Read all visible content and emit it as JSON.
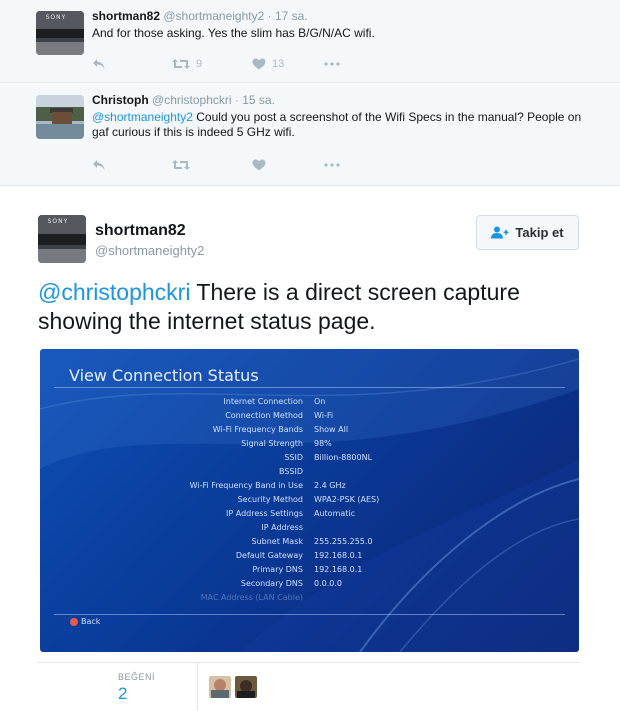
{
  "replies": [
    {
      "fullname": "shortman82",
      "handle": "@shortmaneighty2",
      "separator": "·",
      "time": "17 sa.",
      "text": "And for those asking. Yes the slim has B/G/N/AC wifi.",
      "retweets": "9",
      "likes": "13",
      "avatar_label": "SONY"
    },
    {
      "fullname": "Christoph",
      "handle": "@christophckri",
      "separator": "·",
      "time": "15 sa.",
      "mention": "@shortmaneighty2",
      "text": " Could you post a screenshot of the Wifi Specs in the manual? People on gaf curious if this is indeed 5 GHz wifi.",
      "retweets": "",
      "likes": ""
    }
  ],
  "main_tweet": {
    "fullname": "shortman82",
    "handle": "@shortmaneighty2",
    "avatar_label": "SONY",
    "follow_label": "Takip et",
    "mention": "@christophckri",
    "text": " There is a direct screen capture showing the internet status page."
  },
  "media": {
    "title": "View Connection Status",
    "rows": [
      {
        "k": "Internet Connection",
        "v": "On"
      },
      {
        "k": "Connection Method",
        "v": "Wi-Fi"
      },
      {
        "k": "Wi-Fi Frequency Bands",
        "v": "Show All"
      },
      {
        "k": "Signal Strength",
        "v": "98%"
      },
      {
        "k": "SSID",
        "v": "Billion-8800NL"
      },
      {
        "k": "BSSID",
        "v": ""
      },
      {
        "k": "Wi-Fi Frequency Band in Use",
        "v": "2.4 GHz"
      },
      {
        "k": "Security Method",
        "v": "WPA2-PSK (AES)"
      },
      {
        "k": "IP Address Settings",
        "v": "Automatic"
      },
      {
        "k": "IP Address",
        "v": ""
      },
      {
        "k": "Subnet Mask",
        "v": "255.255.255.0"
      },
      {
        "k": "Default Gateway",
        "v": "192.168.0.1"
      },
      {
        "k": "Primary DNS",
        "v": "192.168.0.1"
      },
      {
        "k": "Secondary DNS",
        "v": "0.0.0.0"
      },
      {
        "k": "MAC Address (LAN Cable)",
        "v": ""
      }
    ],
    "back_label": "Back"
  },
  "stats": {
    "likes_label": "BEĞENİ",
    "likes_count": "2"
  },
  "colors": {
    "accent": "#1b95e0",
    "muted": "#8899a6",
    "icon": "#aab8c2"
  }
}
